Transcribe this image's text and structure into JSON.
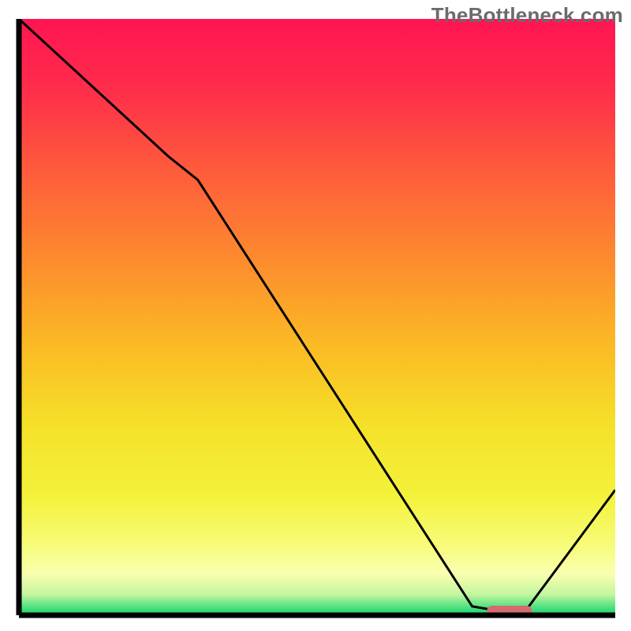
{
  "watermark": "TheBottleneck.com",
  "chart_data": {
    "type": "line",
    "title": "",
    "xlabel": "",
    "ylabel": "",
    "xlim": [
      0,
      100
    ],
    "ylim": [
      0,
      100
    ],
    "series": [
      {
        "name": "bottleneck-curve",
        "x": [
          0,
          25,
          30,
          76,
          80,
          85,
          100
        ],
        "y": [
          100,
          77,
          73,
          1.5,
          0.8,
          0.8,
          21
        ],
        "color": "#000000"
      }
    ],
    "marker": {
      "name": "optimal-range",
      "x_start": 78.5,
      "x_end": 86,
      "y": 0.8,
      "color": "#d66a6f"
    },
    "background_gradient": {
      "stops": [
        {
          "offset": 0.0,
          "color": "#ff1452"
        },
        {
          "offset": 0.12,
          "color": "#ff2e4a"
        },
        {
          "offset": 0.25,
          "color": "#fe5a3c"
        },
        {
          "offset": 0.4,
          "color": "#fd8a2e"
        },
        {
          "offset": 0.55,
          "color": "#fbbb24"
        },
        {
          "offset": 0.68,
          "color": "#f5e029"
        },
        {
          "offset": 0.8,
          "color": "#f4f23b"
        },
        {
          "offset": 0.88,
          "color": "#f7fb76"
        },
        {
          "offset": 0.93,
          "color": "#faffb0"
        },
        {
          "offset": 0.965,
          "color": "#c4f6a0"
        },
        {
          "offset": 0.985,
          "color": "#57e282"
        },
        {
          "offset": 1.0,
          "color": "#0fd469"
        }
      ]
    },
    "axes": {
      "left": {
        "x": 3.0,
        "y0": 3.0,
        "y1": 97.5
      },
      "bottom": {
        "y": 97.5,
        "x0": 3.0,
        "x1": 97.5
      }
    }
  }
}
